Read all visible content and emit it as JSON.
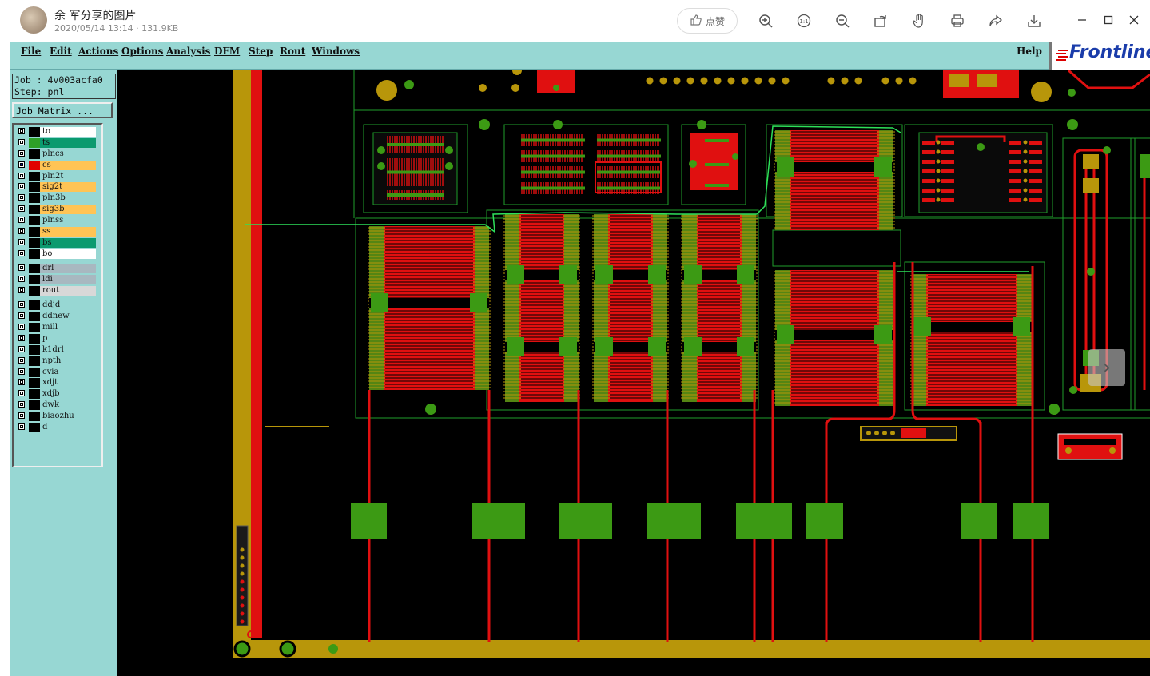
{
  "viewer": {
    "title": "余 军分享的图片",
    "meta": "2020/05/14 13:14 · 131.9KB",
    "like_label": "点赞",
    "tools": [
      "zoom-in-icon",
      "actual-size-icon",
      "zoom-out-icon",
      "rotate-icon",
      "hand-icon",
      "print-icon",
      "share-icon",
      "download-icon"
    ],
    "window": [
      "minimize-icon",
      "maximize-icon",
      "close-icon"
    ]
  },
  "app": {
    "menu": [
      "File",
      "Edit",
      "Actions",
      "Options",
      "Analysis",
      "DFM",
      "Step",
      "Rout",
      "Windows"
    ],
    "help": "Help",
    "logo": "Frontline",
    "job_label": "Job : 4v003acfa0",
    "step_label": "Step: pnl",
    "job_matrix": "Job Matrix ...",
    "layers": [
      {
        "name": "to",
        "color": "#ffffff",
        "swatch": "#000000",
        "checked": false,
        "group": 1
      },
      {
        "name": "ts",
        "color": "#0b9a6f",
        "swatch": "#2ea028",
        "checked": false,
        "group": 1
      },
      {
        "name": "plncs",
        "color": "#97d7d3",
        "swatch": "#000000",
        "checked": false,
        "group": 1
      },
      {
        "name": "cs",
        "color": "#ffc455",
        "swatch": "#e00000",
        "checked": true,
        "group": 1
      },
      {
        "name": "pln2t",
        "color": "#97d7d3",
        "swatch": "#000000",
        "checked": false,
        "group": 1
      },
      {
        "name": "sig2t",
        "color": "#ffc455",
        "swatch": "#000000",
        "checked": false,
        "group": 1
      },
      {
        "name": "pln3b",
        "color": "#97d7d3",
        "swatch": "#000000",
        "checked": false,
        "group": 1
      },
      {
        "name": "sig3b",
        "color": "#ffc455",
        "swatch": "#000000",
        "checked": false,
        "group": 1
      },
      {
        "name": "plnss",
        "color": "#97d7d3",
        "swatch": "#000000",
        "checked": false,
        "group": 1
      },
      {
        "name": "ss",
        "color": "#ffc455",
        "swatch": "#000000",
        "checked": false,
        "group": 1
      },
      {
        "name": "bs",
        "color": "#0b9a6f",
        "swatch": "#000000",
        "checked": false,
        "group": 1
      },
      {
        "name": "bo",
        "color": "#ffffff",
        "swatch": "#000000",
        "checked": false,
        "group": 1
      },
      {
        "name": "drl",
        "color": "#a8b8c0",
        "swatch": "#000000",
        "checked": false,
        "group": 2
      },
      {
        "name": "ldi",
        "color": "#a8b8c0",
        "swatch": "#000000",
        "checked": false,
        "group": 2
      },
      {
        "name": "rout",
        "color": "#d8d8d8",
        "swatch": "#000000",
        "checked": false,
        "group": 2
      },
      {
        "name": "ddjd",
        "color": "#97d7d3",
        "swatch": "#000000",
        "checked": false,
        "group": 3
      },
      {
        "name": "ddnew",
        "color": "#97d7d3",
        "swatch": "#000000",
        "checked": false,
        "group": 3
      },
      {
        "name": "mill",
        "color": "#97d7d3",
        "swatch": "#000000",
        "checked": false,
        "group": 3
      },
      {
        "name": "p",
        "color": "#97d7d3",
        "swatch": "#000000",
        "checked": false,
        "group": 3
      },
      {
        "name": "k1drl",
        "color": "#97d7d3",
        "swatch": "#000000",
        "checked": false,
        "group": 3
      },
      {
        "name": "npth",
        "color": "#97d7d3",
        "swatch": "#000000",
        "checked": false,
        "group": 3
      },
      {
        "name": "cvia",
        "color": "#97d7d3",
        "swatch": "#000000",
        "checked": false,
        "group": 3
      },
      {
        "name": "xdjt",
        "color": "#97d7d3",
        "swatch": "#000000",
        "checked": false,
        "group": 3
      },
      {
        "name": "xdjb",
        "color": "#97d7d3",
        "swatch": "#000000",
        "checked": false,
        "group": 3
      },
      {
        "name": "dwk",
        "color": "#97d7d3",
        "swatch": "#000000",
        "checked": false,
        "group": 3
      },
      {
        "name": "biaozhu",
        "color": "#97d7d3",
        "swatch": "#000000",
        "checked": false,
        "group": 3
      },
      {
        "name": "d",
        "color": "#97d7d3",
        "swatch": "#000000",
        "checked": false,
        "group": 3
      }
    ],
    "colors": {
      "copper": "#e01010",
      "pad": "#3c9a14",
      "frame": "#b8960a",
      "outline": "#1f9e2b",
      "route": "#2ee05a"
    }
  }
}
